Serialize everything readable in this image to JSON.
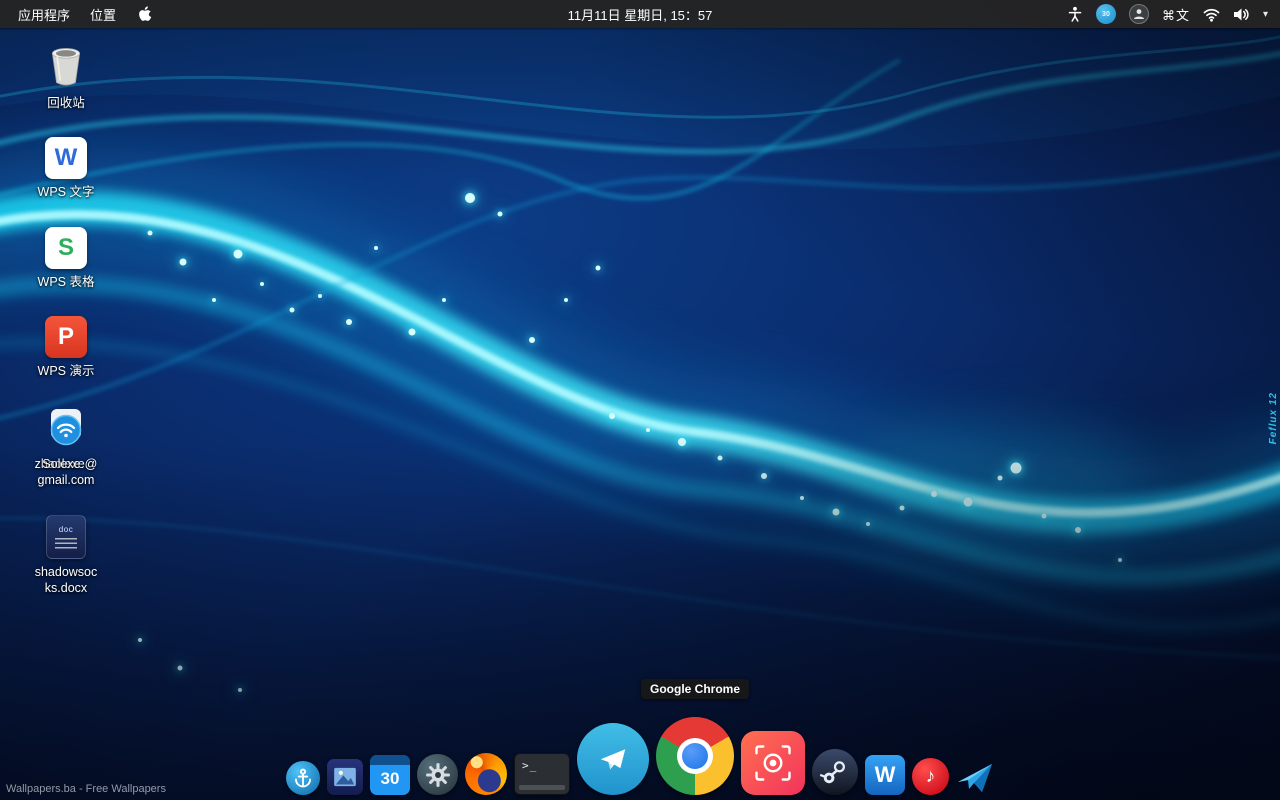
{
  "menubar": {
    "menus": [
      {
        "label": "应用程序"
      },
      {
        "label": "位置"
      }
    ],
    "clock": "11月11日 星期日, 15：57",
    "keyboard_indicator": "⌘文",
    "flux_badge": "30"
  },
  "desktop": {
    "icons": [
      {
        "name": "trash",
        "lines": [
          "回收站",
          ""
        ]
      },
      {
        "name": "wps-writer",
        "letter": "W",
        "lines": [
          "WPS 文字",
          ""
        ]
      },
      {
        "name": "wps-spreadsheets",
        "letter": "S",
        "lines": [
          "WPS 表格",
          ""
        ]
      },
      {
        "name": "wps-presentation",
        "letter": "P",
        "lines": [
          "WPS 演示",
          ""
        ]
      },
      {
        "name": "shadowsocks-account",
        "overlay": "Solexe",
        "lines": [
          "zhaolexe@",
          "gmail.com"
        ]
      },
      {
        "name": "shadowsocks-docx",
        "badge": "doc",
        "lines": [
          "shadowsoc",
          "ks.docx"
        ]
      }
    ],
    "watermark": "Wallpapers.ba - Free Wallpapers",
    "wallpaper_signature": "Feflux 12"
  },
  "dock": {
    "tooltip": "Google Chrome",
    "items": [
      {
        "name": "plank"
      },
      {
        "name": "photos"
      },
      {
        "name": "calendar",
        "badge": "30"
      },
      {
        "name": "settings"
      },
      {
        "name": "firefox"
      },
      {
        "name": "terminal",
        "prompt": ">_"
      },
      {
        "name": "telegram"
      },
      {
        "name": "google-chrome"
      },
      {
        "name": "screenshot"
      },
      {
        "name": "steam"
      },
      {
        "name": "wps-office",
        "letter": "W"
      },
      {
        "name": "netease-music"
      },
      {
        "name": "shadowsocks"
      }
    ]
  },
  "colors": {
    "menubar_bg": "#242424",
    "wave_cyan": "#2ee9ff",
    "wps_writer_blue": "#2f6ad9",
    "wps_sheets_green": "#2fae5d",
    "wps_present_red": "#e6432c",
    "telegram_blue": "#2da4d8",
    "chrome_red": "#e53935",
    "chrome_yellow": "#fbc02d",
    "chrome_green": "#2e9e4f",
    "chrome_blue": "#1a73e8"
  }
}
